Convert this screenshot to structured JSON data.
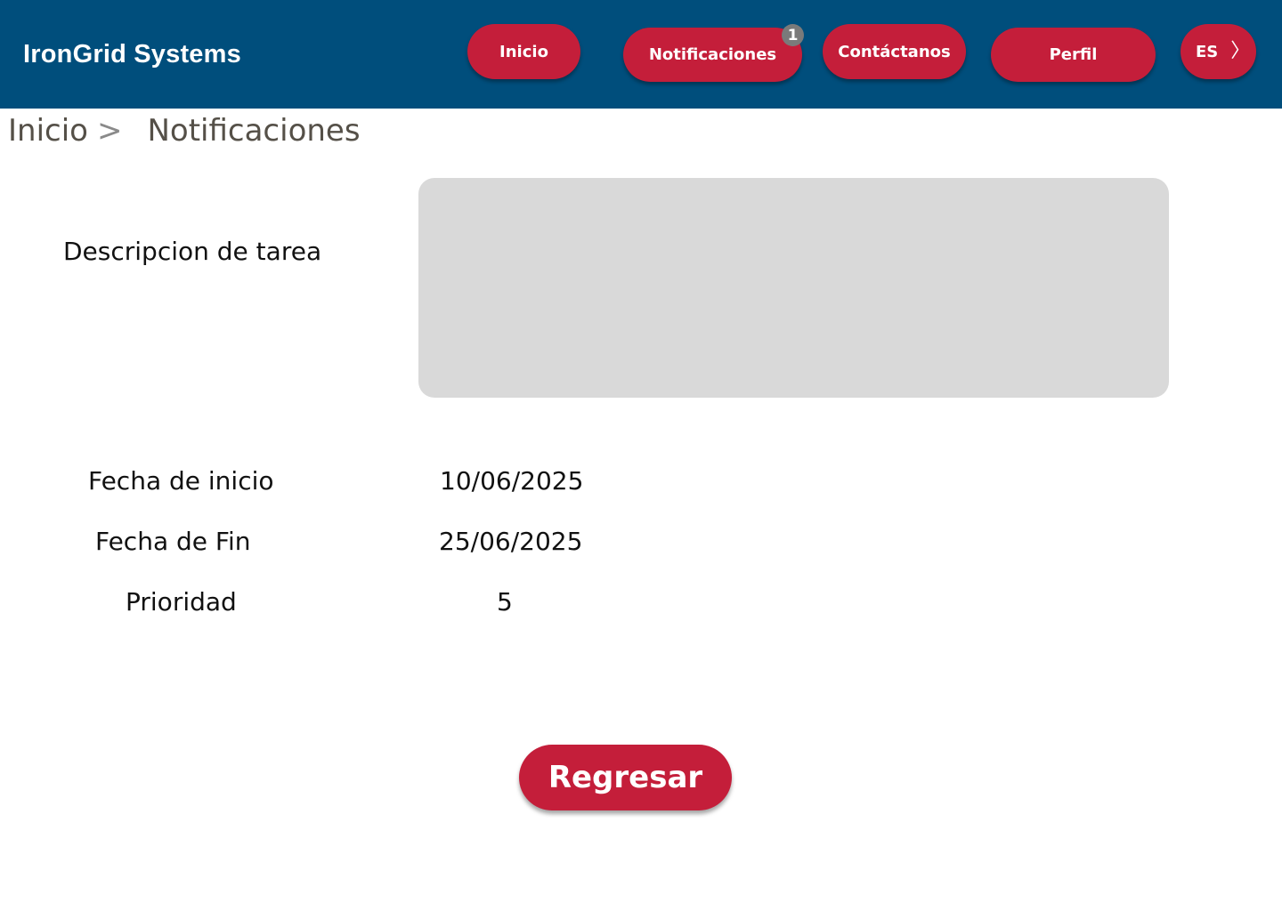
{
  "header": {
    "brand": "IronGrid Systems",
    "nav": {
      "home": "Inicio",
      "notifications": "Notificaciones",
      "notifications_badge": "1",
      "contact": "Contáctanos",
      "profile": "Perfil",
      "language": "ES",
      "language_icon": "chevron-right-icon"
    }
  },
  "breadcrumb": {
    "items": [
      "Inicio",
      "Notificaciones"
    ],
    "separator": ">"
  },
  "task": {
    "description_label": "Descripcion de tarea",
    "description_value": "",
    "start_label": "Fecha de inicio",
    "start_value": "10/06/2025",
    "end_label": "Fecha de Fin",
    "end_value": "25/06/2025",
    "priority_label": "Prioridad",
    "priority_value": "5"
  },
  "actions": {
    "back_label": "Regresar"
  },
  "colors": {
    "header_bg": "#004e7c",
    "accent": "#c41e3a",
    "badge": "#7a7a7a",
    "description_box": "#d9d9d9"
  }
}
